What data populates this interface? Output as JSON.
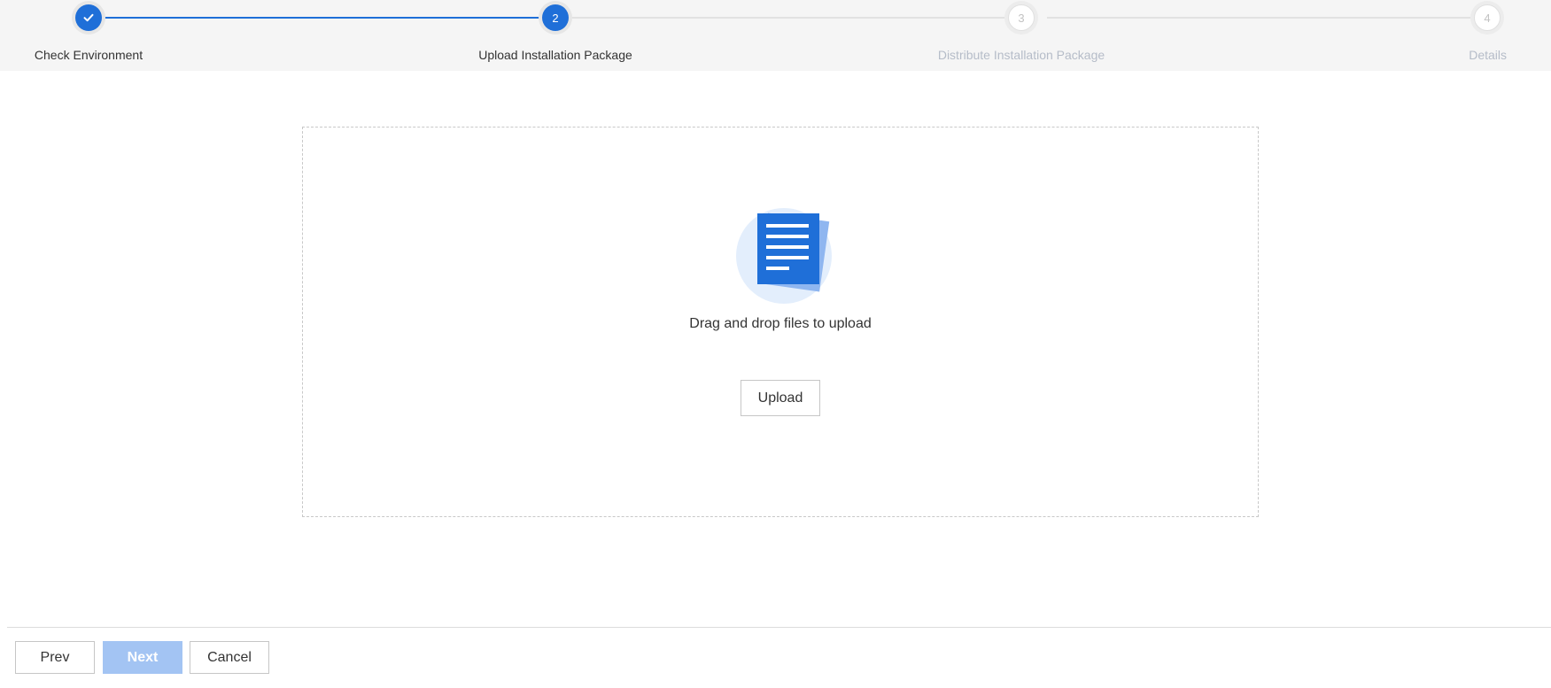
{
  "stepper": {
    "steps": [
      {
        "number": "1",
        "label": "Check Environment",
        "state": "done"
      },
      {
        "number": "2",
        "label": "Upload Installation Package",
        "state": "active"
      },
      {
        "number": "3",
        "label": "Distribute Installation Package",
        "state": "todo"
      },
      {
        "number": "4",
        "label": "Details",
        "state": "todo"
      }
    ]
  },
  "upload": {
    "drop_text": "Drag and drop files to upload",
    "button_label": "Upload"
  },
  "footer": {
    "prev_label": "Prev",
    "next_label": "Next",
    "cancel_label": "Cancel"
  },
  "icons": {
    "step_done": "check-icon",
    "upload": "document-icon"
  },
  "colors": {
    "primary": "#1f6fd8",
    "primary_disabled": "#a3c4f3",
    "inactive_text": "#b5bcc8"
  }
}
